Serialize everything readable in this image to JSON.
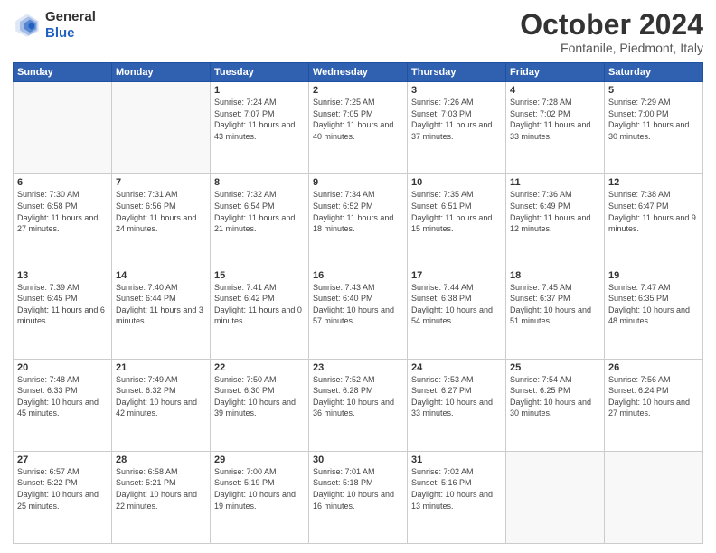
{
  "header": {
    "logo_general": "General",
    "logo_blue": "Blue",
    "month_title": "October 2024",
    "location": "Fontanile, Piedmont, Italy"
  },
  "weekdays": [
    "Sunday",
    "Monday",
    "Tuesday",
    "Wednesday",
    "Thursday",
    "Friday",
    "Saturday"
  ],
  "weeks": [
    [
      {
        "day": null
      },
      {
        "day": null
      },
      {
        "day": "1",
        "sunrise": "Sunrise: 7:24 AM",
        "sunset": "Sunset: 7:07 PM",
        "daylight": "Daylight: 11 hours and 43 minutes."
      },
      {
        "day": "2",
        "sunrise": "Sunrise: 7:25 AM",
        "sunset": "Sunset: 7:05 PM",
        "daylight": "Daylight: 11 hours and 40 minutes."
      },
      {
        "day": "3",
        "sunrise": "Sunrise: 7:26 AM",
        "sunset": "Sunset: 7:03 PM",
        "daylight": "Daylight: 11 hours and 37 minutes."
      },
      {
        "day": "4",
        "sunrise": "Sunrise: 7:28 AM",
        "sunset": "Sunset: 7:02 PM",
        "daylight": "Daylight: 11 hours and 33 minutes."
      },
      {
        "day": "5",
        "sunrise": "Sunrise: 7:29 AM",
        "sunset": "Sunset: 7:00 PM",
        "daylight": "Daylight: 11 hours and 30 minutes."
      }
    ],
    [
      {
        "day": "6",
        "sunrise": "Sunrise: 7:30 AM",
        "sunset": "Sunset: 6:58 PM",
        "daylight": "Daylight: 11 hours and 27 minutes."
      },
      {
        "day": "7",
        "sunrise": "Sunrise: 7:31 AM",
        "sunset": "Sunset: 6:56 PM",
        "daylight": "Daylight: 11 hours and 24 minutes."
      },
      {
        "day": "8",
        "sunrise": "Sunrise: 7:32 AM",
        "sunset": "Sunset: 6:54 PM",
        "daylight": "Daylight: 11 hours and 21 minutes."
      },
      {
        "day": "9",
        "sunrise": "Sunrise: 7:34 AM",
        "sunset": "Sunset: 6:52 PM",
        "daylight": "Daylight: 11 hours and 18 minutes."
      },
      {
        "day": "10",
        "sunrise": "Sunrise: 7:35 AM",
        "sunset": "Sunset: 6:51 PM",
        "daylight": "Daylight: 11 hours and 15 minutes."
      },
      {
        "day": "11",
        "sunrise": "Sunrise: 7:36 AM",
        "sunset": "Sunset: 6:49 PM",
        "daylight": "Daylight: 11 hours and 12 minutes."
      },
      {
        "day": "12",
        "sunrise": "Sunrise: 7:38 AM",
        "sunset": "Sunset: 6:47 PM",
        "daylight": "Daylight: 11 hours and 9 minutes."
      }
    ],
    [
      {
        "day": "13",
        "sunrise": "Sunrise: 7:39 AM",
        "sunset": "Sunset: 6:45 PM",
        "daylight": "Daylight: 11 hours and 6 minutes."
      },
      {
        "day": "14",
        "sunrise": "Sunrise: 7:40 AM",
        "sunset": "Sunset: 6:44 PM",
        "daylight": "Daylight: 11 hours and 3 minutes."
      },
      {
        "day": "15",
        "sunrise": "Sunrise: 7:41 AM",
        "sunset": "Sunset: 6:42 PM",
        "daylight": "Daylight: 11 hours and 0 minutes."
      },
      {
        "day": "16",
        "sunrise": "Sunrise: 7:43 AM",
        "sunset": "Sunset: 6:40 PM",
        "daylight": "Daylight: 10 hours and 57 minutes."
      },
      {
        "day": "17",
        "sunrise": "Sunrise: 7:44 AM",
        "sunset": "Sunset: 6:38 PM",
        "daylight": "Daylight: 10 hours and 54 minutes."
      },
      {
        "day": "18",
        "sunrise": "Sunrise: 7:45 AM",
        "sunset": "Sunset: 6:37 PM",
        "daylight": "Daylight: 10 hours and 51 minutes."
      },
      {
        "day": "19",
        "sunrise": "Sunrise: 7:47 AM",
        "sunset": "Sunset: 6:35 PM",
        "daylight": "Daylight: 10 hours and 48 minutes."
      }
    ],
    [
      {
        "day": "20",
        "sunrise": "Sunrise: 7:48 AM",
        "sunset": "Sunset: 6:33 PM",
        "daylight": "Daylight: 10 hours and 45 minutes."
      },
      {
        "day": "21",
        "sunrise": "Sunrise: 7:49 AM",
        "sunset": "Sunset: 6:32 PM",
        "daylight": "Daylight: 10 hours and 42 minutes."
      },
      {
        "day": "22",
        "sunrise": "Sunrise: 7:50 AM",
        "sunset": "Sunset: 6:30 PM",
        "daylight": "Daylight: 10 hours and 39 minutes."
      },
      {
        "day": "23",
        "sunrise": "Sunrise: 7:52 AM",
        "sunset": "Sunset: 6:28 PM",
        "daylight": "Daylight: 10 hours and 36 minutes."
      },
      {
        "day": "24",
        "sunrise": "Sunrise: 7:53 AM",
        "sunset": "Sunset: 6:27 PM",
        "daylight": "Daylight: 10 hours and 33 minutes."
      },
      {
        "day": "25",
        "sunrise": "Sunrise: 7:54 AM",
        "sunset": "Sunset: 6:25 PM",
        "daylight": "Daylight: 10 hours and 30 minutes."
      },
      {
        "day": "26",
        "sunrise": "Sunrise: 7:56 AM",
        "sunset": "Sunset: 6:24 PM",
        "daylight": "Daylight: 10 hours and 27 minutes."
      }
    ],
    [
      {
        "day": "27",
        "sunrise": "Sunrise: 6:57 AM",
        "sunset": "Sunset: 5:22 PM",
        "daylight": "Daylight: 10 hours and 25 minutes."
      },
      {
        "day": "28",
        "sunrise": "Sunrise: 6:58 AM",
        "sunset": "Sunset: 5:21 PM",
        "daylight": "Daylight: 10 hours and 22 minutes."
      },
      {
        "day": "29",
        "sunrise": "Sunrise: 7:00 AM",
        "sunset": "Sunset: 5:19 PM",
        "daylight": "Daylight: 10 hours and 19 minutes."
      },
      {
        "day": "30",
        "sunrise": "Sunrise: 7:01 AM",
        "sunset": "Sunset: 5:18 PM",
        "daylight": "Daylight: 10 hours and 16 minutes."
      },
      {
        "day": "31",
        "sunrise": "Sunrise: 7:02 AM",
        "sunset": "Sunset: 5:16 PM",
        "daylight": "Daylight: 10 hours and 13 minutes."
      },
      {
        "day": null
      },
      {
        "day": null
      }
    ]
  ]
}
